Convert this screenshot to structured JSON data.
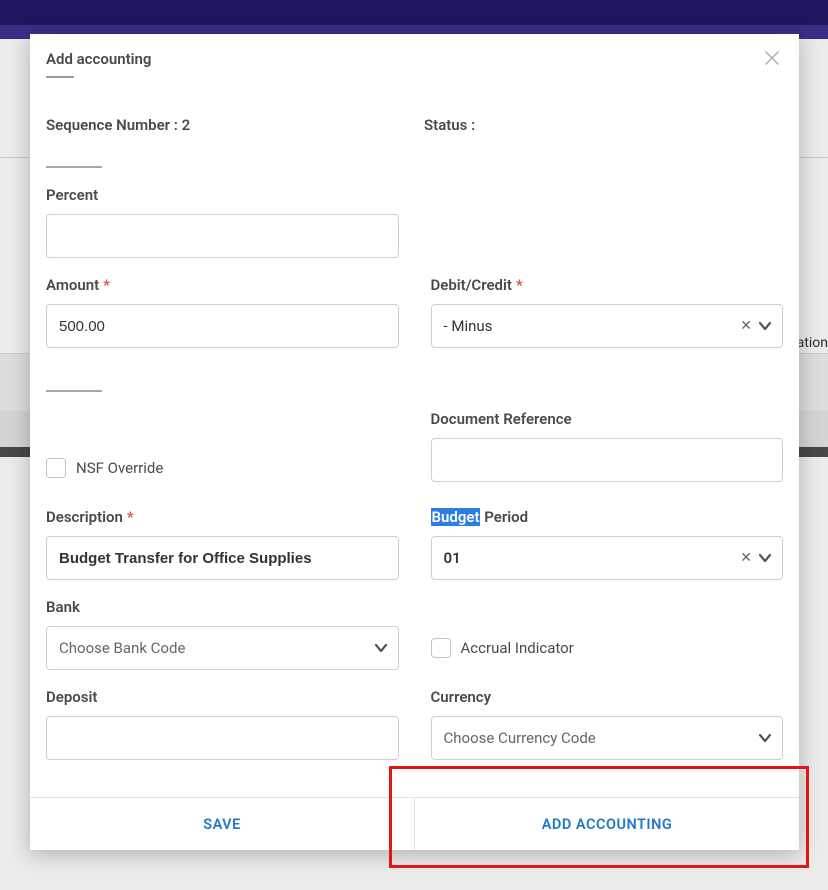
{
  "modal": {
    "title": "Add accounting",
    "sequence_label": "Sequence Number :",
    "sequence_value": "2",
    "status_label": "Status :",
    "status_value": "",
    "fields": {
      "percent": {
        "label": "Percent",
        "value": ""
      },
      "amount": {
        "label": "Amount",
        "value": "500.00"
      },
      "debit_credit": {
        "label": "Debit/Credit",
        "value": "- Minus"
      },
      "nsf_override": {
        "label": "NSF Override"
      },
      "document_reference": {
        "label": "Document Reference",
        "value": ""
      },
      "description": {
        "label": "Description",
        "value": "Budget Transfer for Office Supplies"
      },
      "budget_period": {
        "label_a": "Budget",
        "label_b": " Period",
        "value": "01"
      },
      "bank": {
        "label": "Bank",
        "placeholder": "Choose Bank Code"
      },
      "accrual_indicator": {
        "label": "Accrual Indicator"
      },
      "deposit": {
        "label": "Deposit",
        "value": ""
      },
      "currency": {
        "label": "Currency",
        "placeholder": "Choose Currency Code"
      }
    },
    "buttons": {
      "save": "SAVE",
      "add_accounting": "ADD ACCOUNTING"
    }
  },
  "bg": {
    "right_text": "ization"
  }
}
